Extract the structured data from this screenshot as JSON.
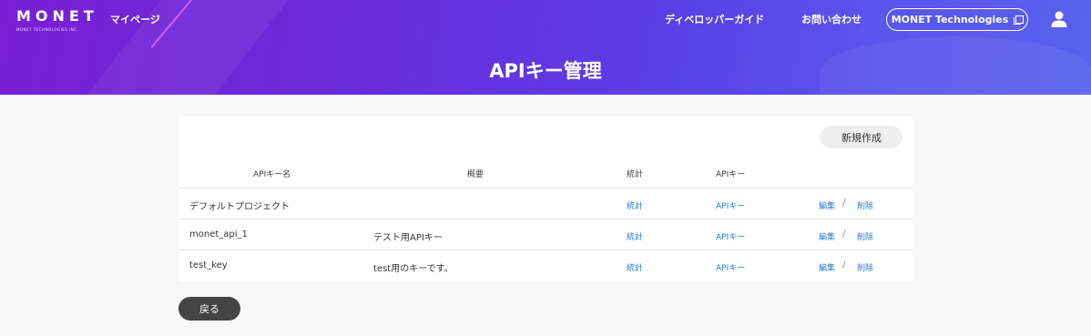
{
  "header": {
    "logo_text": "MONET",
    "logo_sub": "MONET TECHNOLOGIES INC.",
    "mypage": "マイページ",
    "dev_guide": "ディベロッパーガイド",
    "contact": "お問い合わせ",
    "company": "MONET Technologies"
  },
  "page": {
    "title": "APIキー管理"
  },
  "table": {
    "new_button": "新規作成",
    "headers": {
      "name": "APIキー名",
      "summary": "概要",
      "stats": "統計",
      "apikey": "APIキー"
    },
    "rows": [
      {
        "name": "デフォルトプロジェクト",
        "summary": "",
        "stats": "統計",
        "apikey": "APIキー",
        "edit": "編集",
        "delete": "削除"
      },
      {
        "name": "monet_api_1",
        "summary": "テスト用APIキー",
        "stats": "統計",
        "apikey": "APIキー",
        "edit": "編集",
        "delete": "削除"
      },
      {
        "name": "test_key",
        "summary": "test用のキーです。",
        "stats": "統計",
        "apikey": "APIキー",
        "edit": "編集",
        "delete": "削除"
      }
    ],
    "separator": "/"
  },
  "footer": {
    "back": "戻る"
  },
  "colors": {
    "link": "#2b7bd0",
    "header_start": "#7a1fd6",
    "header_end": "#5a62ee"
  }
}
